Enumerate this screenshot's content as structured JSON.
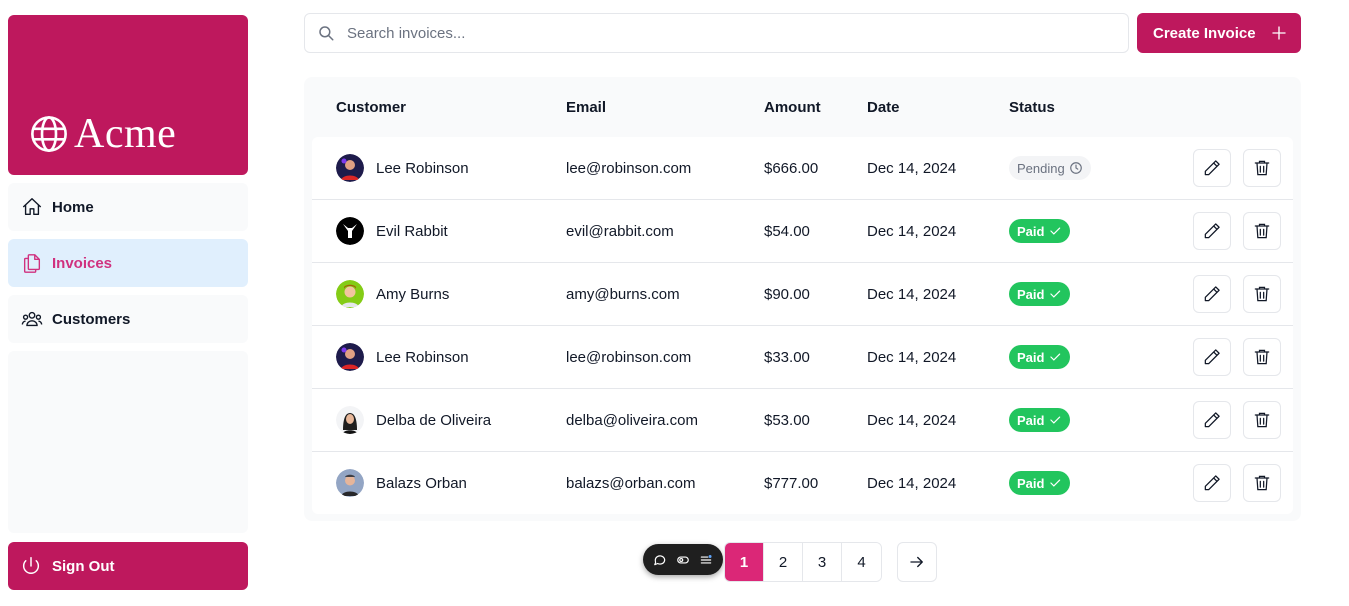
{
  "brand": {
    "name": "Acme",
    "color": "#be185d"
  },
  "sidebar": {
    "items": [
      {
        "label": "Home",
        "icon": "home-icon",
        "active": false
      },
      {
        "label": "Invoices",
        "icon": "document-duplicate-icon",
        "active": true
      },
      {
        "label": "Customers",
        "icon": "user-group-icon",
        "active": false
      }
    ],
    "sign_out": "Sign Out"
  },
  "search": {
    "placeholder": "Search invoices...",
    "value": ""
  },
  "create_button": {
    "label": "Create Invoice"
  },
  "table": {
    "columns": [
      "Customer",
      "Email",
      "Amount",
      "Date",
      "Status"
    ],
    "rows": [
      {
        "name": "Lee Robinson",
        "email": "lee@robinson.com",
        "amount": "$666.00",
        "date": "Dec 14, 2024",
        "status": "Pending"
      },
      {
        "name": "Evil Rabbit",
        "email": "evil@rabbit.com",
        "amount": "$54.00",
        "date": "Dec 14, 2024",
        "status": "Paid"
      },
      {
        "name": "Amy Burns",
        "email": "amy@burns.com",
        "amount": "$90.00",
        "date": "Dec 14, 2024",
        "status": "Paid"
      },
      {
        "name": "Lee Robinson",
        "email": "lee@robinson.com",
        "amount": "$33.00",
        "date": "Dec 14, 2024",
        "status": "Paid"
      },
      {
        "name": "Delba de Oliveira",
        "email": "delba@oliveira.com",
        "amount": "$53.00",
        "date": "Dec 14, 2024",
        "status": "Paid"
      },
      {
        "name": "Balazs Orban",
        "email": "balazs@orban.com",
        "amount": "$777.00",
        "date": "Dec 14, 2024",
        "status": "Paid"
      }
    ]
  },
  "pagination": {
    "pages": [
      "1",
      "2",
      "3",
      "4"
    ],
    "current": "1"
  },
  "colors": {
    "paid": "#22c55e",
    "pending_bg": "#f3f4f6",
    "active_page": "#db2777",
    "active_nav_bg": "#e0effd"
  }
}
